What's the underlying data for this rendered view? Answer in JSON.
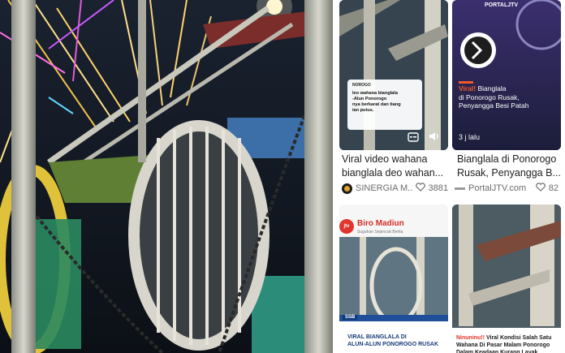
{
  "cards": [
    {
      "overlay": {
        "brand": "NOROGO",
        "lines": [
          "leo wahana bianglala",
          "-Alun Ponorogo",
          "nya berkarat dan tiang",
          "ian putus."
        ]
      },
      "title": [
        "Viral video wahana",
        "bianglala deo wahan..."
      ],
      "source": "SINERGIA M...",
      "likes": "3881"
    },
    {
      "overlay": {
        "brand": "PORTALJTV",
        "headline_accent": "Viral!",
        "headline": [
          "Bianglala",
          "di Ponorogo Rusak,",
          "Penyangga Besi Patah"
        ],
        "time": "3 j lalu"
      },
      "title": [
        "Bianglala di Ponorogo",
        "Rusak, Penyangga B..."
      ],
      "source": "PortalJTV.com",
      "likes": "82"
    },
    {
      "overlay": {
        "brand": "Biro Madiun",
        "tagline": "Suguhan Sepincuk Berita",
        "logo": "jtv",
        "badge": "SSB",
        "headline": [
          "VIRAL BIANGLALA DI",
          "ALUN-ALUN PONOROGO RUSAK"
        ]
      }
    },
    {
      "overlay": {
        "accent": "Ninuninu!!",
        "headline": "Viral Kondisi Salah Satu Wahana Di Pasar Malam Ponorogo Dalam Keadaan Kurang Layak"
      }
    }
  ]
}
